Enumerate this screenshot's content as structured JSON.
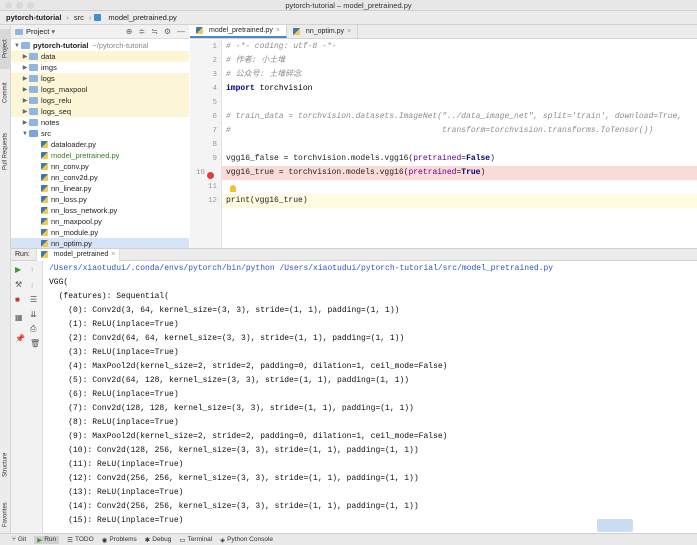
{
  "window": {
    "title": "pytorch-tutorial – model_pretrained.py"
  },
  "breadcrumb": [
    "pytorch-tutorial",
    "src",
    "model_pretrained.py"
  ],
  "left_strip": {
    "project": "Project",
    "commit": "Commit",
    "pull_requests": "Pull Requests",
    "structure": "Structure",
    "favorites": "Favorites"
  },
  "project_panel": {
    "header": "Project",
    "tree": [
      {
        "label": "pytorch-tutorial",
        "extra": "~/pytorch-tutorial",
        "type": "root"
      },
      {
        "label": "data",
        "type": "folder",
        "yellow": true
      },
      {
        "label": "imgs",
        "type": "folder"
      },
      {
        "label": "logs",
        "type": "folder",
        "yellow": true
      },
      {
        "label": "logs_maxpool",
        "type": "folder",
        "yellow": true
      },
      {
        "label": "logs_relu",
        "type": "folder",
        "yellow": true
      },
      {
        "label": "logs_seq",
        "type": "folder",
        "yellow": true
      },
      {
        "label": "notes",
        "type": "folder"
      },
      {
        "label": "src",
        "type": "folder-open"
      },
      {
        "label": "dataloader.py",
        "type": "file"
      },
      {
        "label": "model_pretrained.py",
        "type": "file",
        "green": true
      },
      {
        "label": "nn_conv.py",
        "type": "file"
      },
      {
        "label": "nn_conv2d.py",
        "type": "file"
      },
      {
        "label": "nn_linear.py",
        "type": "file"
      },
      {
        "label": "nn_loss.py",
        "type": "file"
      },
      {
        "label": "nn_loss_network.py",
        "type": "file"
      },
      {
        "label": "nn_maxpool.py",
        "type": "file"
      },
      {
        "label": "nn_module.py",
        "type": "file"
      },
      {
        "label": "nn_optim.py",
        "type": "file",
        "selected": true
      }
    ]
  },
  "editor": {
    "tabs": [
      {
        "label": "model_pretrained.py",
        "active": true
      },
      {
        "label": "nn_optim.py",
        "active": false
      }
    ],
    "line_numbers": [
      "1",
      "2",
      "3",
      "4",
      "5",
      "6",
      "7",
      "8",
      "9",
      "10",
      "11",
      "12"
    ],
    "lines": {
      "l1": "# -*- coding: utf-8 -*-",
      "l2": "# 作者: 小土堆",
      "l3": "# 公众号: 土堆碎念",
      "l4_kw": "import",
      "l4_rest": " torchvision",
      "l6": "# train_data = torchvision.datasets.ImageNet(\"../data_image_net\", split='train', download=True,",
      "l7": "#                                            transform=torchvision.transforms.ToTensor())",
      "l9_a": "vgg16_false = torchvision.models.vgg16(",
      "l9_p": "pretrained",
      "l9_b": "=",
      "l9_k": "False",
      "l9_c": ")",
      "l10_a": "vgg16_true = torchvision.models.vgg16(",
      "l10_p": "pretrained",
      "l10_b": "=",
      "l10_k": "True",
      "l10_c": ")",
      "l12_a": "print",
      "l12_b": "(vgg16_true)"
    }
  },
  "run": {
    "label": "Run:",
    "tab": "model_pretrained",
    "output": [
      "/Users/xiaotudui/.conda/envs/pytorch/bin/python /Users/xiaotudui/pytorch-tutorial/src/model_pretrained.py",
      "VGG(",
      "  (features): Sequential(",
      "    (0): Conv2d(3, 64, kernel_size=(3, 3), stride=(1, 1), padding=(1, 1))",
      "    (1): ReLU(inplace=True)",
      "    (2): Conv2d(64, 64, kernel_size=(3, 3), stride=(1, 1), padding=(1, 1))",
      "    (3): ReLU(inplace=True)",
      "    (4): MaxPool2d(kernel_size=2, stride=2, padding=0, dilation=1, ceil_mode=False)",
      "    (5): Conv2d(64, 128, kernel_size=(3, 3), stride=(1, 1), padding=(1, 1))",
      "    (6): ReLU(inplace=True)",
      "    (7): Conv2d(128, 128, kernel_size=(3, 3), stride=(1, 1), padding=(1, 1))",
      "    (8): ReLU(inplace=True)",
      "    (9): MaxPool2d(kernel_size=2, stride=2, padding=0, dilation=1, ceil_mode=False)",
      "    (10): Conv2d(128, 256, kernel_size=(3, 3), stride=(1, 1), padding=(1, 1))",
      "    (11): ReLU(inplace=True)",
      "    (12): Conv2d(256, 256, kernel_size=(3, 3), stride=(1, 1), padding=(1, 1))",
      "    (13): ReLU(inplace=True)",
      "    (14): Conv2d(256, 256, kernel_size=(3, 3), stride=(1, 1), padding=(1, 1))",
      "    (15): ReLU(inplace=True)"
    ]
  },
  "bottom_bar": {
    "git": "Git",
    "run": "Run",
    "todo": "TODO",
    "problems": "Problems",
    "debug": "Debug",
    "terminal": "Terminal",
    "python_console": "Python Console"
  },
  "colors": {
    "accent": "#4a88c7",
    "breakpoint": "#e03c3c",
    "yellow_folder_bg": "#fdf6d6"
  }
}
